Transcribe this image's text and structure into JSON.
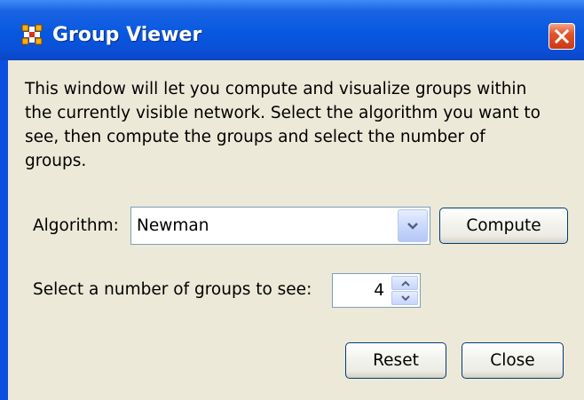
{
  "window": {
    "title": "Group Viewer",
    "icon": "network-nodes-icon",
    "close_icon": "close-icon"
  },
  "description": {
    "lines": [
      "This window will let you compute and visualize groups within",
      "the currently visible network. Select the algorithm you want to",
      "see, then compute the groups and select the number of",
      "groups."
    ]
  },
  "algorithm": {
    "label": "Algorithm:",
    "selected": "Newman",
    "compute_label": "Compute"
  },
  "groups": {
    "label": "Select a number of groups to see:",
    "value": "4"
  },
  "buttons": {
    "reset_label": "Reset",
    "close_label": "Close"
  },
  "colors": {
    "titlebar": "#0758e0",
    "client_bg": "#ece9d8",
    "close_button": "#e0542c",
    "icon_accent": "#f5b400"
  }
}
